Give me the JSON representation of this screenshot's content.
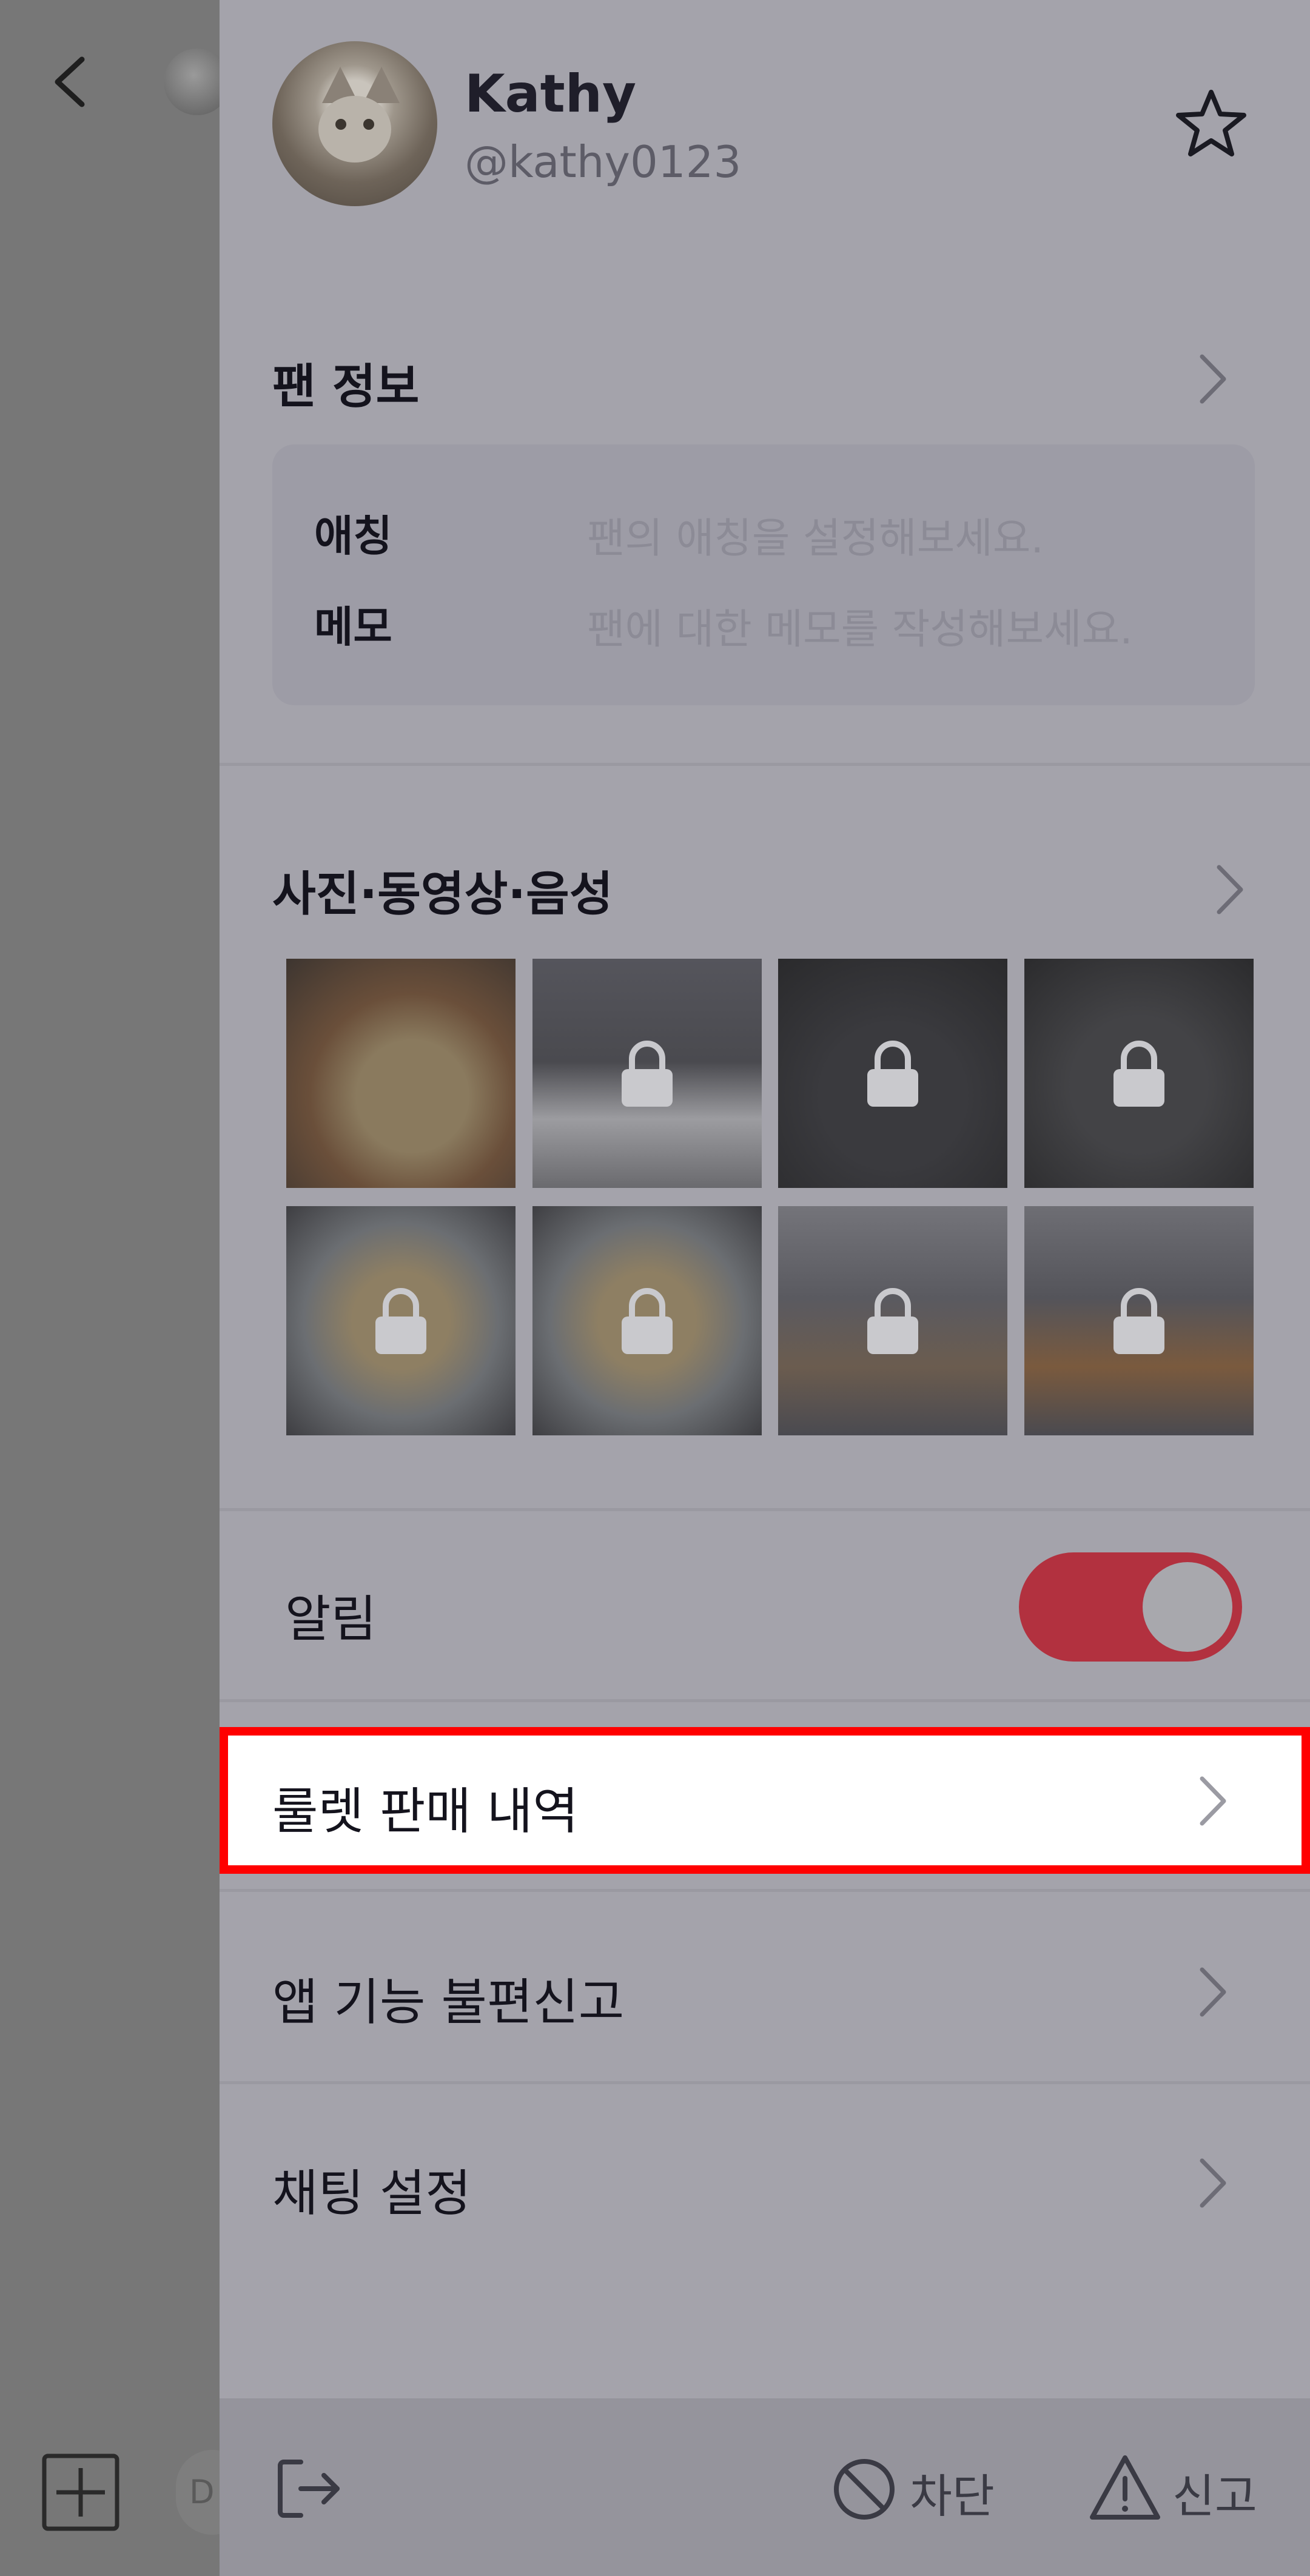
{
  "profile": {
    "name": "Kathy",
    "handle": "@kathy0123"
  },
  "fan_info": {
    "title": "팬 정보",
    "nickname_label": "애칭",
    "nickname_placeholder": "팬의 애칭을 설정해보세요.",
    "memo_label": "메모",
    "memo_placeholder": "팬에 대한 메모를 작성해보세요."
  },
  "media": {
    "title": "사진·동영상·음성"
  },
  "notification": {
    "label": "알림",
    "enabled": true
  },
  "menu": {
    "roulette_sales": "룰렛 판매 내역",
    "report_app": "앱 기능 불편신고",
    "chat_settings": "채팅 설정"
  },
  "bottom": {
    "block": "차단",
    "report": "신고"
  },
  "background": {
    "pill_text": "D"
  },
  "colors": {
    "toggle_on": "#b2313f",
    "highlight_border": "#ff0000"
  },
  "icons": [
    "back-icon",
    "star-icon",
    "chevron-right-icon",
    "lock-icon",
    "exit-icon",
    "block-icon",
    "warning-icon",
    "plus-icon"
  ]
}
